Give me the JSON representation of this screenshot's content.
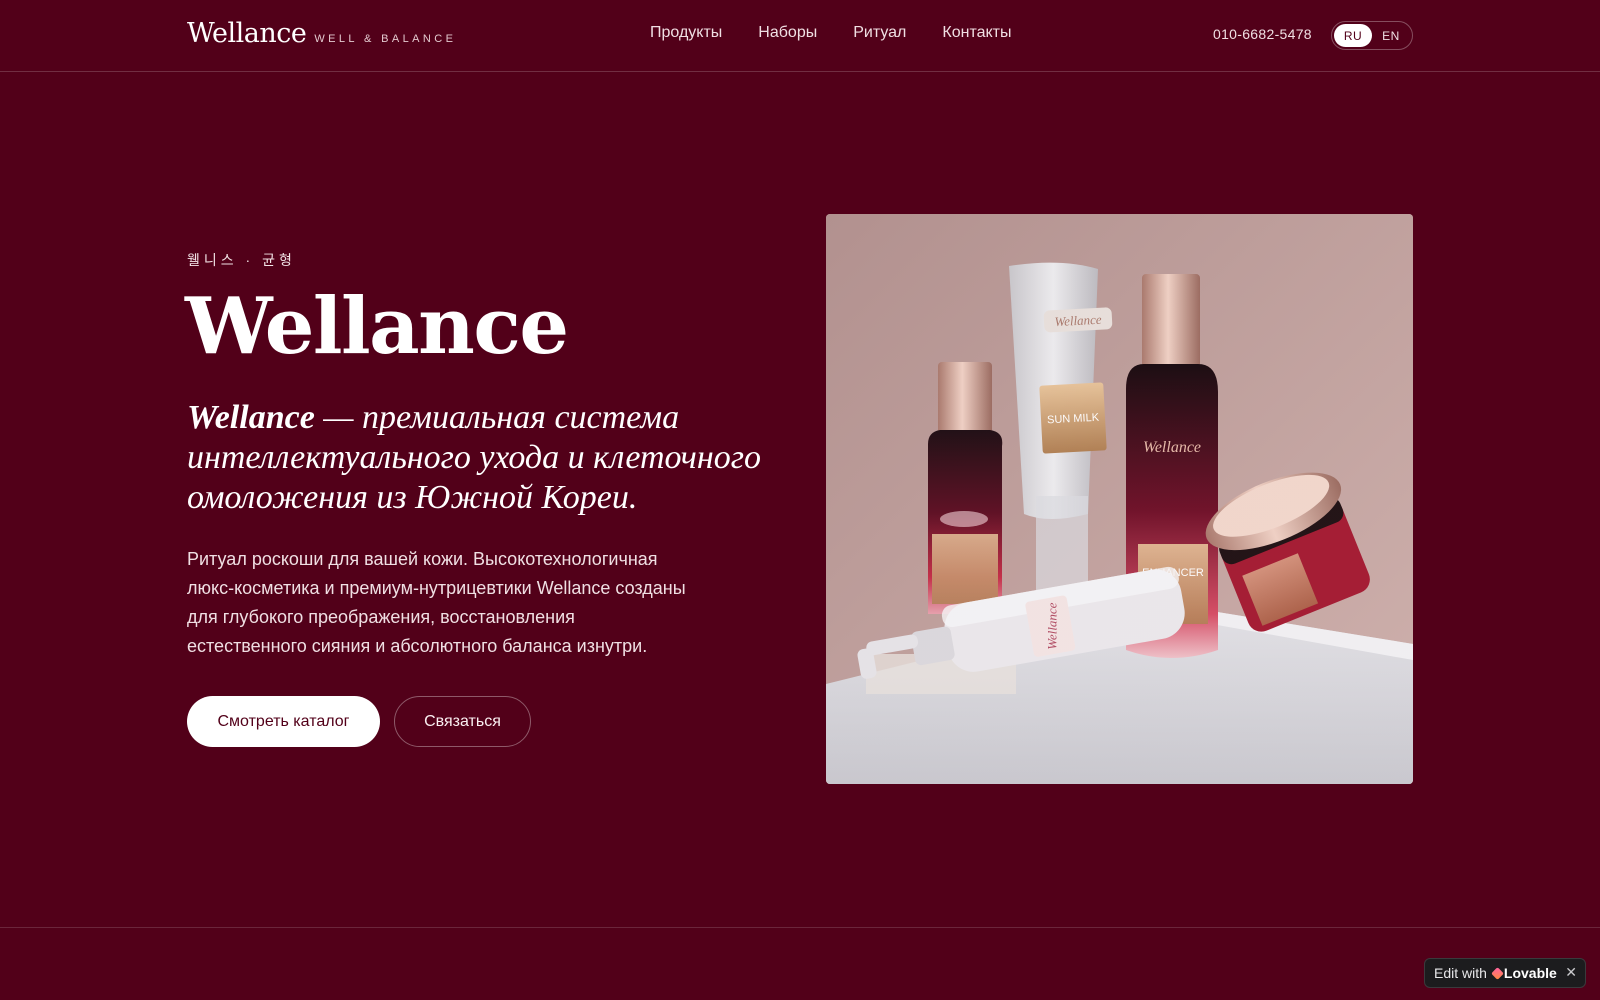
{
  "header": {
    "logo": "Wellance",
    "tagline": "WELL & BALANCE",
    "nav": [
      {
        "label": "Продукты"
      },
      {
        "label": "Наборы"
      },
      {
        "label": "Ритуал"
      },
      {
        "label": "Контакты"
      }
    ],
    "phone": "010-6682-5478",
    "languages": [
      {
        "label": "RU",
        "active": true
      },
      {
        "label": "EN",
        "active": false
      }
    ]
  },
  "hero": {
    "eyebrow": "웰니스 · 균형",
    "title": "Wellance",
    "subtitle_brand": "Wellance",
    "subtitle_rest": " — премиальная система интеллектуального ухода и клеточного омоложения из Южной Кореи.",
    "body": "Ритуал роскоши для вашей кожи. Высокотехнологичная люкс-косметика и премиум-нутрицевтики Wellance созданы для глубокого преображения, восстановления естественного сияния и абсолютного баланса изнутри.",
    "primary_button": "Смотреть каталог",
    "secondary_button": "Связаться",
    "image_labels": {
      "tube_brand": "Wellance",
      "tube_product": "SUN MILK",
      "bottle_brand": "Wellance",
      "bottle_product": "ENHANCER",
      "pump_brand": "Wellance"
    }
  },
  "badge": {
    "prefix": "Edit with",
    "brand": "Lovable",
    "close": "✕"
  },
  "colors": {
    "background": "#520019",
    "accent": "#ffffff",
    "text_muted": "#f0dfe3"
  }
}
